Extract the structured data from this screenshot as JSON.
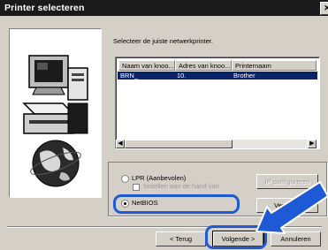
{
  "window": {
    "title": "Printer selecteren",
    "close_icon": "close-icon"
  },
  "instruction": "Selecteer de juiste netwerkprinter.",
  "printer_list": {
    "columns": [
      "Naam van knoo...",
      "Adres van knoo...",
      "Printernaam"
    ],
    "rows": [
      [
        "BRN_",
        "10.",
        "Brother"
      ]
    ]
  },
  "options": {
    "lpr_label": "LPR (Aanbevolen)",
    "manual_label": "Instellen aan de hand van",
    "netbios_label": "NetBIOS",
    "selected": "NetBIOS"
  },
  "side_buttons": {
    "ip_config": "IP configureren",
    "browse": "Ver"
  },
  "buttons": {
    "back": "< Terug",
    "next": "Volgende >",
    "cancel": "Annuleren"
  },
  "colors": {
    "highlight": "#1f5ad6",
    "selection": "#0a246a",
    "titlebar": "#1a1a1a"
  }
}
